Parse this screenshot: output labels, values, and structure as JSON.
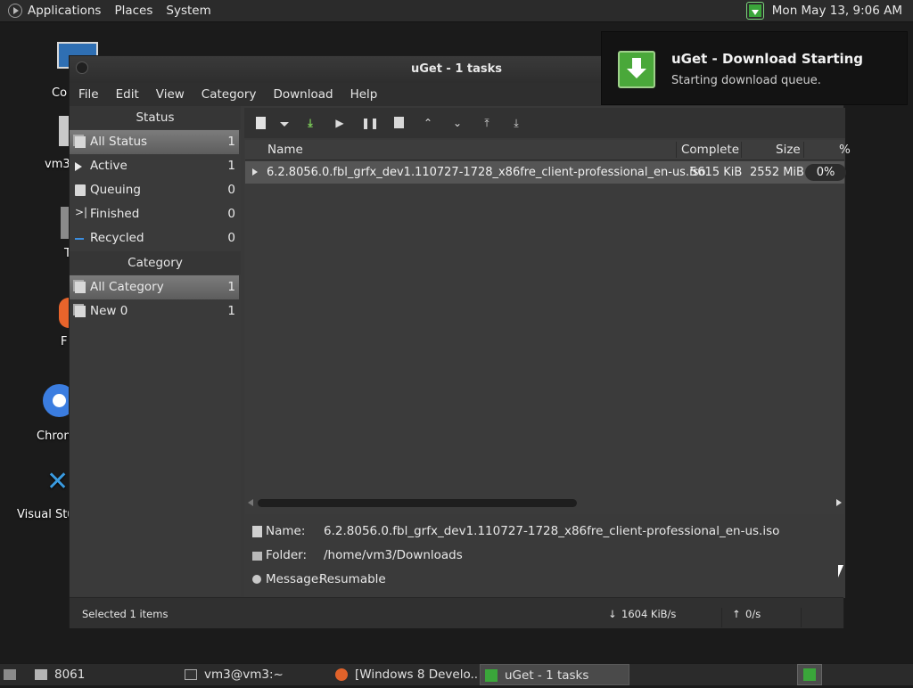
{
  "top_panel": {
    "menus": [
      "Applications",
      "Places",
      "System"
    ],
    "clock": "Mon May 13,  9:06 AM"
  },
  "desktop": {
    "icons": [
      {
        "label": "Co",
        "icon": "computer-icon"
      },
      {
        "label": "vm3",
        "icon": "home-folder-icon"
      },
      {
        "label": "T",
        "icon": "trash-icon"
      },
      {
        "label": "F",
        "icon": "firefox-icon"
      },
      {
        "label": "Chron",
        "icon": "chrome-icon"
      },
      {
        "label": "Visual Stu",
        "icon": "vscode-icon"
      }
    ]
  },
  "notification": {
    "title": "uGet - Download Starting",
    "body": "Starting download queue.",
    "icon": "uget-icon"
  },
  "window": {
    "title": "uGet - 1 tasks",
    "menus": [
      "File",
      "Edit",
      "View",
      "Category",
      "Download",
      "Help"
    ]
  },
  "sidebar": {
    "status_header": "Status",
    "status_items": [
      {
        "label": "All Status",
        "count": "1",
        "icon": "document-stack-icon"
      },
      {
        "label": "Active",
        "count": "1",
        "icon": "play-icon"
      },
      {
        "label": "Queuing",
        "count": "0",
        "icon": "document-icon"
      },
      {
        "label": "Finished",
        "count": "0",
        "icon": "finished-icon"
      },
      {
        "label": "Recycled",
        "count": "0",
        "icon": "recycled-icon"
      }
    ],
    "category_header": "Category",
    "category_items": [
      {
        "label": "All Category",
        "count": "1",
        "icon": "document-stack-icon"
      },
      {
        "label": "New 0",
        "count": "1",
        "icon": "document-stack-icon"
      }
    ]
  },
  "toolbar": {
    "buttons": [
      "new-download-icon",
      "dropdown-arrow-icon",
      "save-down-icon",
      "play-icon",
      "pause-icon",
      "properties-icon",
      "move-up-icon",
      "move-down-icon",
      "move-top-icon",
      "move-bottom-icon"
    ]
  },
  "list": {
    "headers": {
      "name": "Name",
      "complete": "Complete",
      "size": "Size",
      "percent": "%"
    },
    "rows": [
      {
        "name": "6.2.8056.0.fbl_grfx_dev1.110727-1728_x86fre_client-professional_en-us.iso",
        "complete": "5615 KiB",
        "size": "2552 MiB",
        "percent": "0%"
      }
    ]
  },
  "details": {
    "name_label": "Name:",
    "name_value": "6.2.8056.0.fbl_grfx_dev1.110727-1728_x86fre_client-professional_en-us.iso",
    "folder_label": "Folder:",
    "folder_value": "/home/vm3/Downloads",
    "message_label": "Message:",
    "message_value": "Resumable"
  },
  "statusbar": {
    "selected": "Selected 1 items",
    "down_speed": "1604 KiB/s",
    "up_speed": "0/s"
  },
  "taskbar": {
    "items": [
      {
        "label": "8061",
        "icon": "folder-icon"
      },
      {
        "label": "vm3@vm3:~",
        "icon": "terminal-icon"
      },
      {
        "label": "[Windows 8 Develo...",
        "icon": "firefox-icon"
      },
      {
        "label": "uGet - 1 tasks",
        "icon": "uget-icon"
      }
    ]
  }
}
